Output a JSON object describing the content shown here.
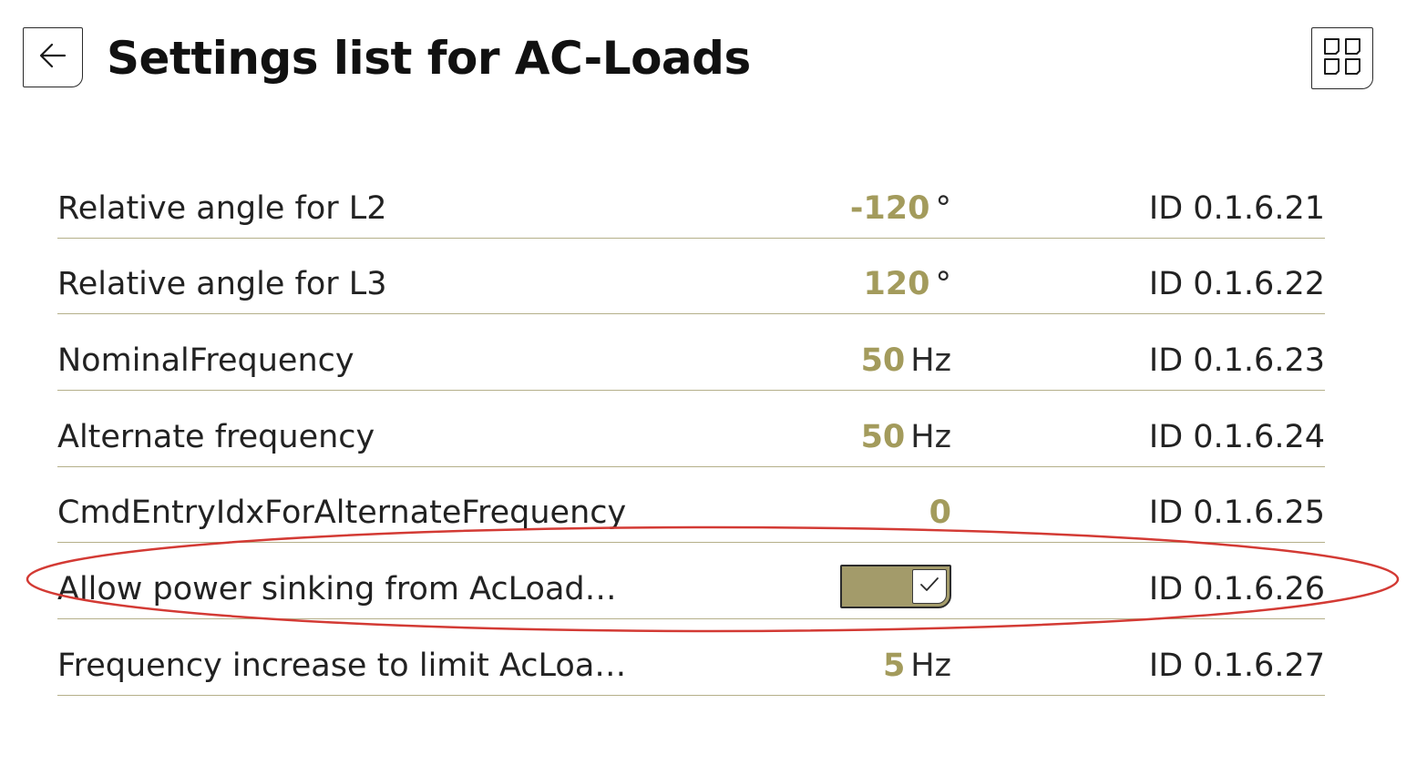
{
  "header": {
    "title": "Settings list for AC-Loads",
    "back_icon": "arrow-left-icon",
    "grid_icon": "grid-icon"
  },
  "colors": {
    "accent": "#a39b5c",
    "toggle_on": "#a39b6a",
    "divider": "#b5b08a",
    "highlight": "#d33a34"
  },
  "settings": [
    {
      "label": "Relative angle for L2",
      "value": "-120",
      "unit": "°",
      "id": "ID 0.1.6.21"
    },
    {
      "label": "Relative angle for L3",
      "value": "120",
      "unit": "°",
      "id": "ID 0.1.6.22"
    },
    {
      "label": "NominalFrequency",
      "value": "50",
      "unit": "Hz",
      "id": "ID 0.1.6.23"
    },
    {
      "label": "Alternate frequency",
      "value": "50",
      "unit": "Hz",
      "id": "ID 0.1.6.24"
    },
    {
      "label": "CmdEntryIdxForAlternateFrequency",
      "value": "0",
      "unit": "",
      "id": "ID 0.1.6.25"
    },
    {
      "label": "Allow power sinking from AcLoad…",
      "toggle": true,
      "id": "ID 0.1.6.26"
    },
    {
      "label": "Frequency increase to limit AcLoa…",
      "value": "5",
      "unit": "Hz",
      "id": "ID 0.1.6.27"
    }
  ]
}
